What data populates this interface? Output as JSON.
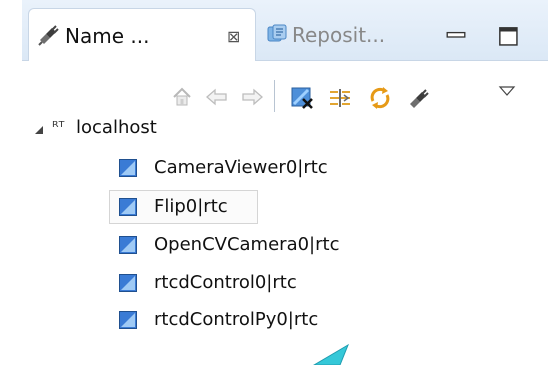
{
  "tabs": [
    {
      "label": "Name ...",
      "active": true,
      "icon": "plug-icon"
    },
    {
      "label": "Reposit...",
      "active": false,
      "icon": "repository-icon"
    }
  ],
  "tab_close_glyph": "⊠",
  "view_controls": {
    "minimize": "minimize-icon",
    "maximize": "maximize-icon",
    "menu": "view-menu-icon"
  },
  "toolbar": {
    "buttons": [
      "home-icon",
      "back-icon",
      "forward-icon",
      "disconnect-icon",
      "link-icon",
      "refresh-icon",
      "plug-icon"
    ]
  },
  "tree": {
    "root": {
      "glyph": "ᴿᵀ",
      "label": "localhost",
      "expanded": true
    },
    "items": [
      {
        "label": "CameraViewer0|rtc",
        "selected": false
      },
      {
        "label": "Flip0|rtc",
        "selected": true
      },
      {
        "label": "OpenCVCamera0|rtc",
        "selected": false
      },
      {
        "label": "rtcdControl0|rtc",
        "selected": false
      },
      {
        "label": "rtcdControlPy0|rtc",
        "selected": false
      }
    ]
  },
  "colors": {
    "tab_bg": "#dbe8f6",
    "accent_blue": "#3a7bd5",
    "icon_orange": "#e69a17",
    "teal": "#35c8d8"
  }
}
